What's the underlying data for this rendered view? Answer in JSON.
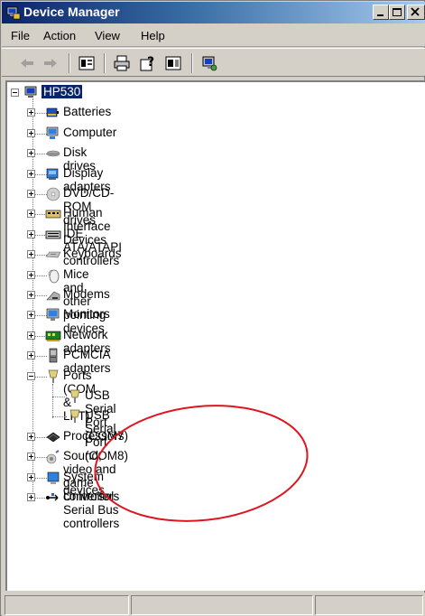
{
  "window": {
    "title": "Device Manager"
  },
  "menu": {
    "items": [
      "File",
      "Action",
      "View",
      "Help"
    ]
  },
  "toolbar": {
    "buttons": [
      "back-icon",
      "forward-icon",
      "properties-icon",
      "print-icon",
      "help-icon",
      "toggle-pane-icon",
      "scan-hardware-icon"
    ]
  },
  "tree": {
    "root": "HP530",
    "categories": [
      {
        "label": "Batteries",
        "icon": "battery-icon"
      },
      {
        "label": "Computer",
        "icon": "computer-icon"
      },
      {
        "label": "Disk drives",
        "icon": "disk-drive-icon"
      },
      {
        "label": "Display adapters",
        "icon": "display-adapter-icon"
      },
      {
        "label": "DVD/CD-ROM drives",
        "icon": "dvd-drive-icon"
      },
      {
        "label": "Human Interface Devices",
        "icon": "hid-icon"
      },
      {
        "label": "IDE ATA/ATAPI controllers",
        "icon": "ide-controller-icon"
      },
      {
        "label": "Keyboards",
        "icon": "keyboard-icon"
      },
      {
        "label": "Mice and other pointing devices",
        "icon": "mouse-icon"
      },
      {
        "label": "Modems",
        "icon": "modem-icon"
      },
      {
        "label": "Monitors",
        "icon": "monitor-icon"
      },
      {
        "label": "Network adapters",
        "icon": "network-adapter-icon"
      },
      {
        "label": "PCMCIA adapters",
        "icon": "pcmcia-icon"
      },
      {
        "label": "Ports (COM & LPT)",
        "icon": "port-icon",
        "expanded": true,
        "children": [
          {
            "label": "USB Serial Port (COM7)",
            "icon": "port-icon"
          },
          {
            "label": "USB Serial Port (COM8)",
            "icon": "port-icon"
          }
        ]
      },
      {
        "label": "Processors",
        "icon": "processor-icon"
      },
      {
        "label": "Sound, video and game controllers",
        "icon": "sound-icon"
      },
      {
        "label": "System devices",
        "icon": "system-device-icon"
      },
      {
        "label": "Universal Serial Bus controllers",
        "icon": "usb-icon"
      }
    ]
  },
  "colors": {
    "title_start": "#0a246a",
    "title_end": "#a6caf0",
    "selection": "#0a246a",
    "highlight_circle": "#e0141e",
    "chrome": "#d4d0c8"
  }
}
